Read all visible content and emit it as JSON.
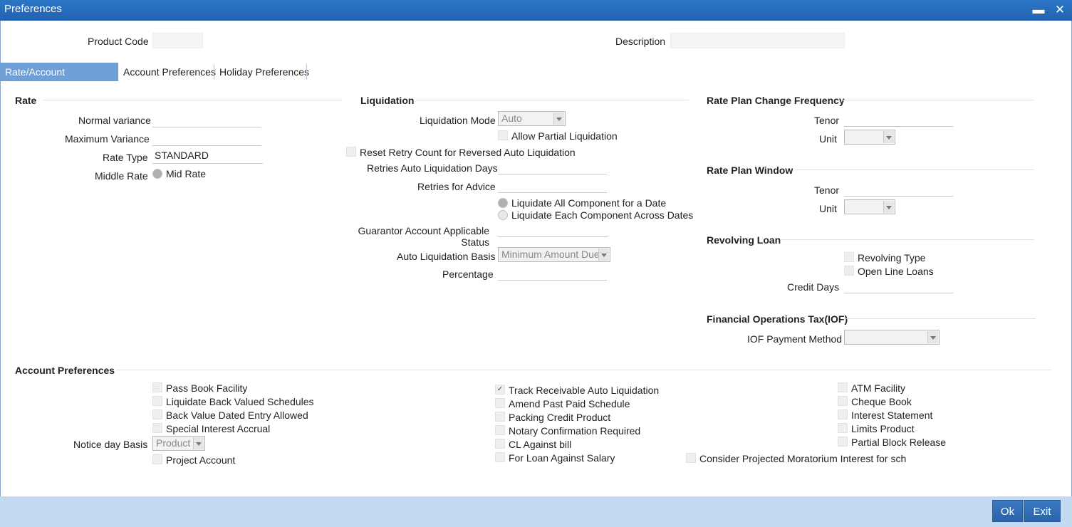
{
  "window": {
    "title": "Preferences"
  },
  "header": {
    "product_code_label": "Product Code",
    "description_label": "Description"
  },
  "tabs": [
    {
      "label": "Rate/Account Preferences"
    },
    {
      "label": "Account Preferences"
    },
    {
      "label": "Holiday Preferences"
    }
  ],
  "rate": {
    "title": "Rate",
    "normal_variance_label": "Normal variance",
    "maximum_variance_label": "Maximum Variance",
    "rate_type_label": "Rate Type",
    "rate_type_value": "STANDARD",
    "middle_rate_label": "Middle Rate",
    "mid_rate_option": "Mid Rate"
  },
  "liquidation": {
    "title": "Liquidation",
    "mode_label": "Liquidation Mode",
    "mode_value": "Auto",
    "allow_partial": "Allow Partial Liquidation",
    "reset_retry": "Reset Retry Count for Reversed Auto Liquidation",
    "retries_days_label": "Retries Auto Liquidation Days",
    "retries_advice_label": "Retries for Advice",
    "liquidate_all": "Liquidate All Component for a Date",
    "liquidate_each": "Liquidate Each Component Across Dates",
    "guarantor_label_1": "Guarantor Account Applicable",
    "guarantor_label_2": "Status",
    "auto_basis_label": "Auto Liquidation Basis",
    "auto_basis_value": "Minimum Amount Due",
    "percentage_label": "Percentage"
  },
  "rate_plan_change": {
    "title": "Rate Plan Change Frequency",
    "tenor_label": "Tenor",
    "unit_label": "Unit"
  },
  "rate_plan_window": {
    "title": "Rate Plan Window",
    "tenor_label": "Tenor",
    "unit_label": "Unit"
  },
  "revolving_loan": {
    "title": "Revolving Loan",
    "revolving_type": "Revolving Type",
    "open_line_loans": "Open Line Loans",
    "credit_days_label": "Credit Days"
  },
  "iof": {
    "title": "Financial Operations Tax(IOF)",
    "payment_method_label": "IOF Payment Method"
  },
  "account_preferences": {
    "title": "Account Preferences",
    "col1": [
      "Pass Book Facility",
      "Liquidate Back Valued Schedules",
      "Back Value Dated Entry Allowed",
      "Special Interest Accrual"
    ],
    "notice_day_basis_label": "Notice day Basis",
    "notice_day_basis_value": "Product",
    "project_account": "Project Account",
    "col2": [
      "Track Receivable Auto Liquidation",
      "Amend Past Paid Schedule",
      "Packing Credit Product",
      "Notary Confirmation Required",
      "CL Against bill",
      "For Loan Against Salary"
    ],
    "col3": [
      "ATM Facility",
      "Cheque Book",
      "Interest Statement",
      "Limits Product",
      "Partial Block Release"
    ],
    "projected_moratorium": "Consider Projected Moratorium Interest for sch"
  },
  "footer": {
    "ok_label": "Ok",
    "exit_label": "Exit"
  },
  "icons": {
    "minimize": "minimize-icon",
    "close": "close-icon"
  },
  "colors": {
    "titlebar": "#2262b0",
    "active_tab": "#6e9fd6",
    "footer": "#c3daf0",
    "button": "#2a63a8"
  }
}
